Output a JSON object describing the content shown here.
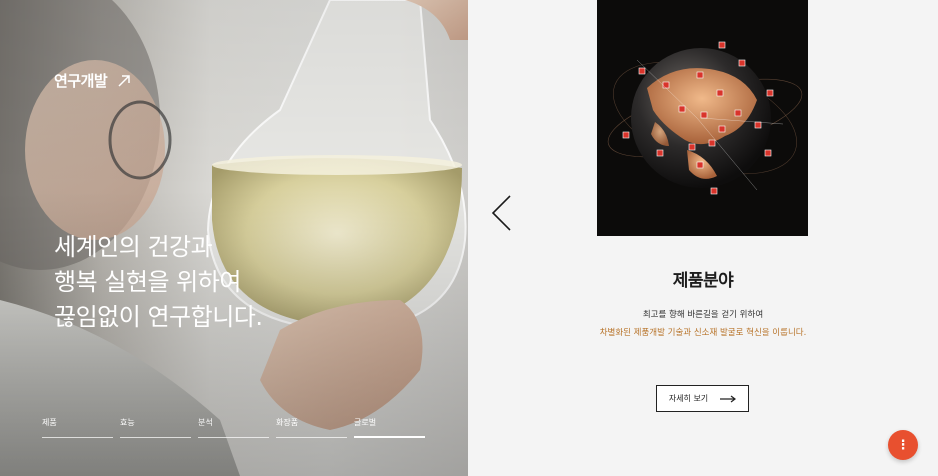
{
  "hero": {
    "link_label": "연구개발",
    "headline": [
      "세계인의 건강과",
      "행복 실현을 위하여",
      "끊임없이 연구합니다."
    ],
    "tabs": [
      {
        "label": "제품"
      },
      {
        "label": "효능"
      },
      {
        "label": "분석"
      },
      {
        "label": "화장품"
      },
      {
        "label": "글로벌"
      }
    ],
    "active_tab": "글로벌"
  },
  "product": {
    "title": "제품분야",
    "description_line1": "최고를 향해 바른길을 걷기 위하여",
    "description_line2": "차별화된 제품개발 기술과 신소재 발굴로 혁신을 이룹니다.",
    "more_label": "자세히 보기"
  },
  "colors": {
    "accent_text": "#b8742a",
    "fab": "#e8502f",
    "marker": "#d9342b"
  },
  "icons": {
    "link_arrow": "arrow-up-right-icon",
    "prev": "chevron-left-icon",
    "more_arrow": "arrow-right-icon",
    "fab": "more-vertical-icon"
  }
}
